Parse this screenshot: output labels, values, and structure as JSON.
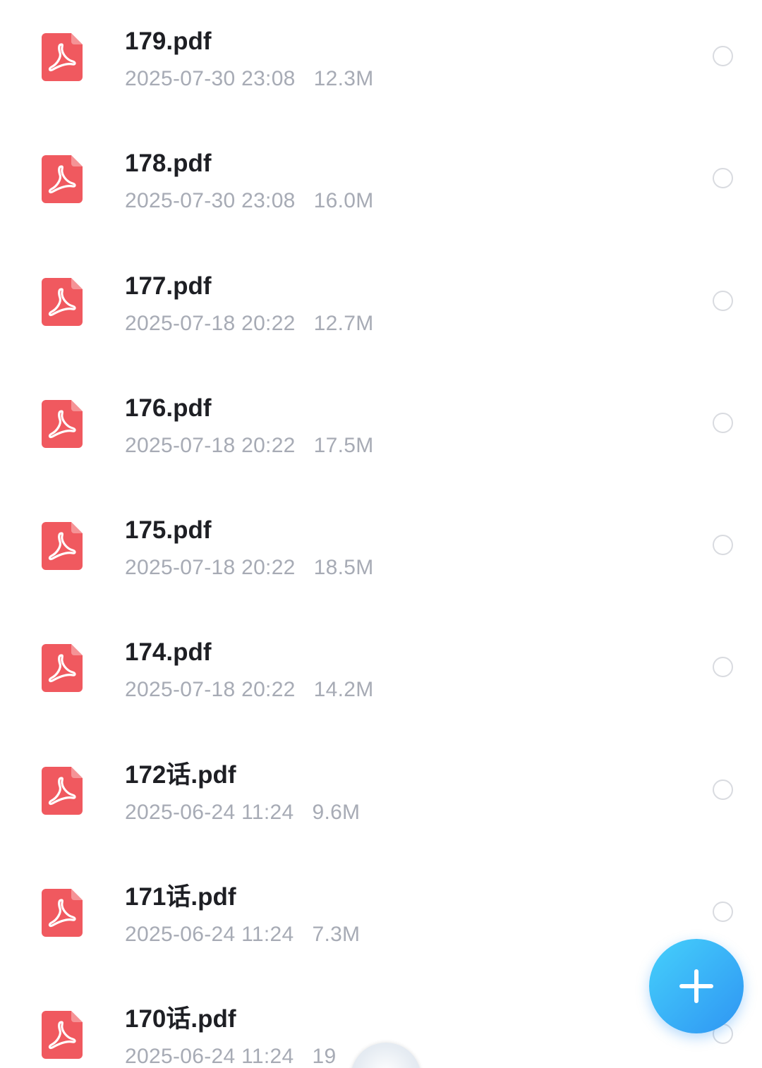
{
  "colors": {
    "pdf_icon": "#f0595f",
    "file_name": "#1e1f24",
    "file_meta": "#a7abb5",
    "radio_border": "#d9dbe0",
    "fab_gradient_start": "#45d0fb",
    "fab_gradient_end": "#2f95f3"
  },
  "icons": {
    "file": "pdf-file-icon",
    "select": "radio-circle-icon",
    "add": "plus-icon"
  },
  "files": [
    {
      "name": "179.pdf",
      "date": "2025-07-30 23:08",
      "size": "12.3M"
    },
    {
      "name": "178.pdf",
      "date": "2025-07-30 23:08",
      "size": "16.0M"
    },
    {
      "name": "177.pdf",
      "date": "2025-07-18 20:22",
      "size": "12.7M"
    },
    {
      "name": "176.pdf",
      "date": "2025-07-18 20:22",
      "size": "17.5M"
    },
    {
      "name": "175.pdf",
      "date": "2025-07-18 20:22",
      "size": "18.5M"
    },
    {
      "name": "174.pdf",
      "date": "2025-07-18 20:22",
      "size": "14.2M"
    },
    {
      "name": "172话.pdf",
      "date": "2025-06-24 11:24",
      "size": "9.6M"
    },
    {
      "name": "171话.pdf",
      "date": "2025-06-24 11:24",
      "size": "7.3M"
    },
    {
      "name": "170话.pdf",
      "date": "2025-06-24 11:24",
      "size": "19"
    }
  ]
}
